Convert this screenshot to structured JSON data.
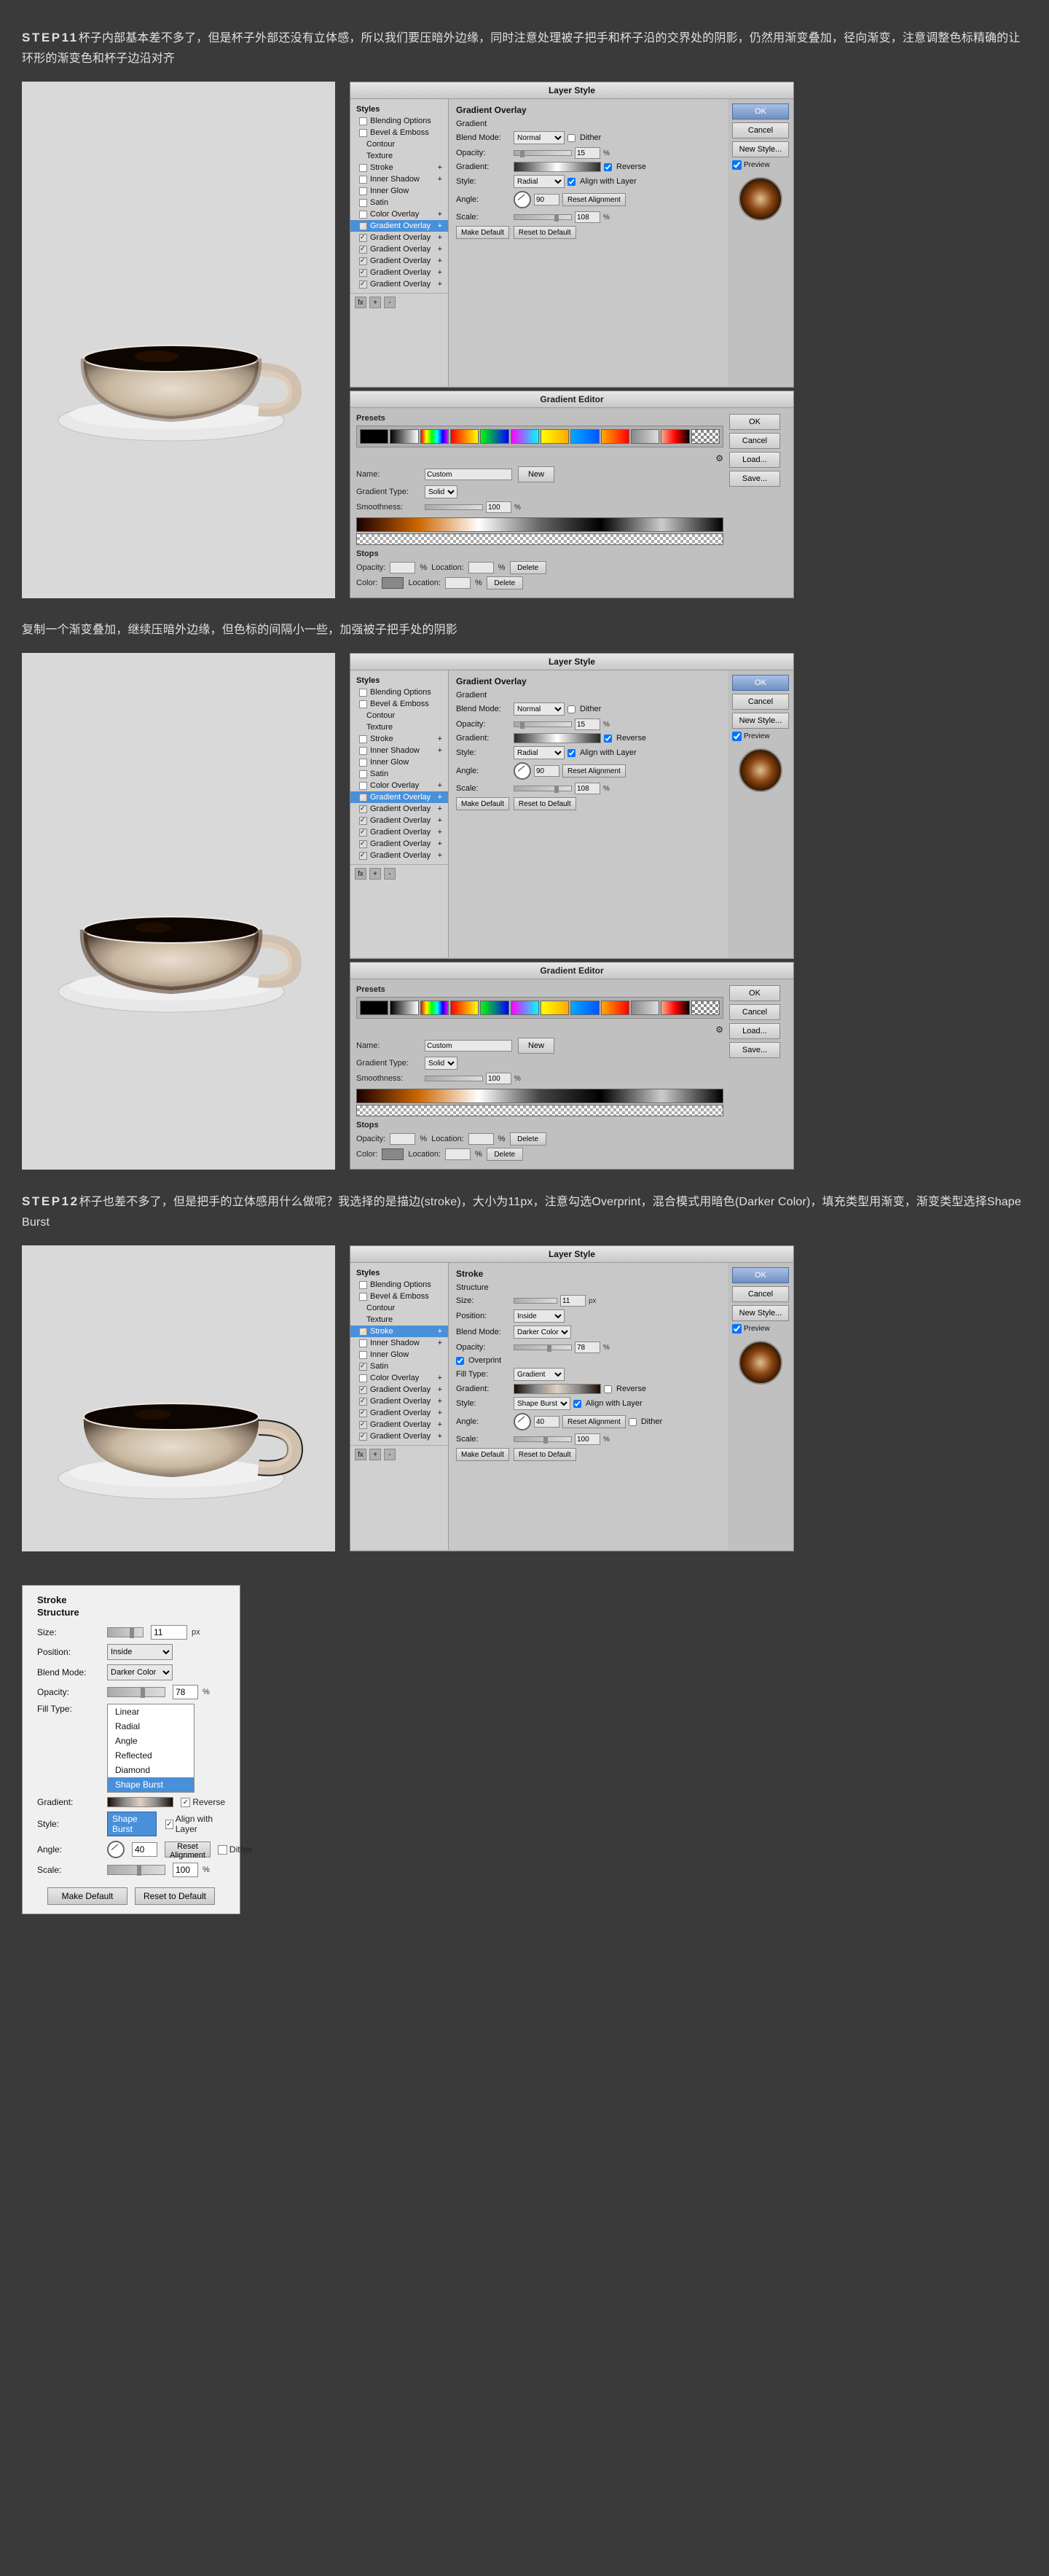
{
  "page": {
    "bg_color": "#3a3a3a"
  },
  "step11": {
    "heading": "STEP11杯子内部基本差不多了，但是杯子外部还没有立体感，所以我们要压暗外边缘，同时注意处理被子把手和杯子沿的交界处的阴影，仍然用渐变叠加，径向渐变，注意调整色标精确的让环形的渐变色和杯子边沿对齐"
  },
  "step11b": {
    "heading": "复制一个渐变叠加，继续压暗外边缘，但色标的间隔小一些，加强被子把手处的阴影"
  },
  "step12": {
    "heading": "STEP12杯子也差不多了，但是把手的立体感用什么做呢？我选择的是描边(stroke)，大小为11px，注意勾选Overprint，混合模式用暗色(Darker Color)，填充类型用渐变，渐变类型选择Shape Burst"
  },
  "panels": {
    "layer_style_title": "Layer Style",
    "gradient_editor_title": "Gradient Editor",
    "styles_title": "Styles",
    "ok_label": "OK",
    "cancel_label": "Cancel",
    "new_style_label": "New Style...",
    "preview_label": "Preview",
    "make_default_label": "Make Default",
    "reset_to_default_label": "Reset to Default",
    "load_label": "Load...",
    "save_label": "Save...",
    "new_label": "New",
    "delete_label": "Delete"
  },
  "styles_list_1": [
    {
      "label": "Blending Options",
      "active": false,
      "checked": false
    },
    {
      "label": "Bevel & Emboss",
      "active": false,
      "checked": false
    },
    {
      "label": "Contour",
      "active": false,
      "checked": false
    },
    {
      "label": "Texture",
      "active": false,
      "checked": false
    },
    {
      "label": "Stroke",
      "active": false,
      "checked": false,
      "has_plus": true
    },
    {
      "label": "Inner Shadow",
      "active": false,
      "checked": false,
      "has_plus": true
    },
    {
      "label": "Inner Glow",
      "active": false,
      "checked": false
    },
    {
      "label": "Satin",
      "active": false,
      "checked": false
    },
    {
      "label": "Color Overlay",
      "active": false,
      "checked": false,
      "has_plus": true
    },
    {
      "label": "Gradient Overlay",
      "active": true,
      "checked": true,
      "has_plus": true
    },
    {
      "label": "Gradient Overlay",
      "active": false,
      "checked": true,
      "has_plus": true
    },
    {
      "label": "Gradient Overlay",
      "active": false,
      "checked": true,
      "has_plus": true
    },
    {
      "label": "Gradient Overlay",
      "active": false,
      "checked": true,
      "has_plus": true
    },
    {
      "label": "Gradient Overlay",
      "active": false,
      "checked": true,
      "has_plus": true
    },
    {
      "label": "Gradient Overlay",
      "active": false,
      "checked": true,
      "has_plus": true
    }
  ],
  "gradient_overlay_1": {
    "title": "Gradient Overlay",
    "subtitle": "Gradient",
    "blend_mode_label": "Blend Mode:",
    "blend_mode_value": "Normal",
    "dither_label": "Dither",
    "opacity_label": "Opacity:",
    "opacity_value": "15",
    "opacity_unit": "%",
    "gradient_label": "Gradient:",
    "reverse_label": "Reverse",
    "style_label": "Style:",
    "style_value": "Radial",
    "align_label": "Align with Layer",
    "angle_label": "Angle:",
    "angle_value": "90",
    "reset_alignment_label": "Reset Alignment",
    "scale_label": "Scale:",
    "scale_value": "108",
    "scale_unit": "%"
  },
  "gradient_editor_1": {
    "presets_label": "Presets",
    "name_label": "Name:",
    "name_value": "Custom",
    "gradient_type_label": "Gradient Type:",
    "gradient_type_value": "Solid",
    "smoothness_label": "Smoothness:",
    "smoothness_value": "100",
    "smoothness_unit": "%",
    "stops_label": "Stops",
    "opacity_label": "Opacity:",
    "opacity_unit": "%",
    "location_label": "Location:",
    "location_unit": "%",
    "color_label": "Color:",
    "color_location_label": "Location:",
    "color_location_unit": "%"
  },
  "stroke_panel": {
    "title": "Stroke",
    "subtitle": "Structure",
    "size_label": "Size:",
    "size_value": "11",
    "size_unit": "px",
    "position_label": "Position:",
    "position_value": "Inside",
    "blend_mode_label": "Blend Mode:",
    "blend_mode_value": "Darker Color",
    "opacity_label": "Opacity:",
    "opacity_value": "78",
    "opacity_unit": "%",
    "overprint_label": "Overprint",
    "fill_type_label": "Fill Type:",
    "fill_type_value": "Gradient",
    "gradient_label": "Gradient:",
    "reverse_label": "Reverse",
    "style_label": "Style:",
    "style_value": "Shape Burst",
    "align_label": "Align with Layer",
    "angle_label": "Angle:",
    "angle_value": "40",
    "reset_alignment_label": "Reset Alignment",
    "dither_label": "Dither",
    "scale_label": "Scale:",
    "scale_value": "100",
    "scale_unit": "%"
  },
  "dropdown_popup": {
    "title": "Stroke",
    "subtitle": "Structure",
    "size_label": "Size:",
    "size_value": "11",
    "size_unit": "px",
    "position_label": "Position:",
    "position_value": "Inside",
    "blend_mode_label": "Blend Mode:",
    "blend_mode_value": "Darker Color",
    "opacity_label": "Opacity:",
    "opacity_value": "78",
    "opacity_unit": "%",
    "fill_type_label": "Fill Type:",
    "gradient_label": "Gradient:",
    "reverse_label": "Reverse",
    "style_label": "Style:",
    "align_label": "Align with Layer",
    "angle_label": "Angle:",
    "angle_value": "40",
    "reset_alignment_label": "Reset Alignment",
    "dither_label": "Dither",
    "scale_label": "Scale:",
    "scale_value": "100",
    "scale_unit": "%",
    "make_default_label": "Make Default",
    "reset_to_default_label": "Reset to Default",
    "dropdown_items": [
      "Linear",
      "Radial",
      "Angle",
      "Reflected",
      "Diamond",
      "Shape Burst"
    ]
  },
  "presets_swatches": [
    "#000",
    "#444",
    "#888",
    "#ccc",
    "#fff",
    "linear-gradient(to right, #000, #fff)",
    "linear-gradient(to right, #f00, #ff0, #0f0, #0ff, #00f)",
    "linear-gradient(to right, #f0f, #ff0)",
    "linear-gradient(to right, #000, #f00)",
    "#0af",
    "linear-gradient(to right, #fa0, #f00)",
    "linear-gradient(to right, #0f0, #000)"
  ]
}
